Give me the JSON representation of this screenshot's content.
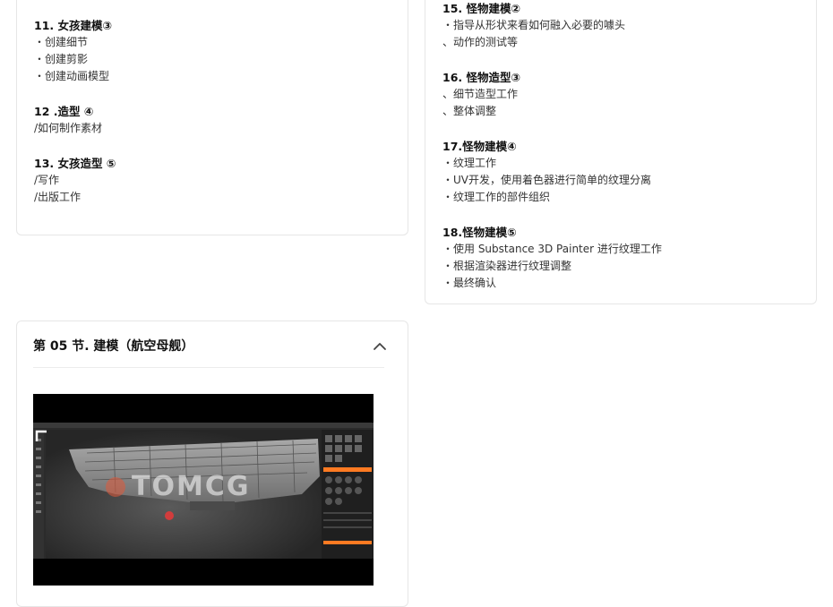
{
  "left_lessons": [
    {
      "title": "11. 女孩建模③",
      "lines": [
        "・创建细节",
        "・创建剪影",
        "・创建动画模型"
      ]
    },
    {
      "title": "12 .造型 ④",
      "lines": [
        "/如何制作素材"
      ]
    },
    {
      "title": "13. 女孩造型 ⑤",
      "lines": [
        "/写作",
        "/出版工作"
      ]
    }
  ],
  "right_lessons": [
    {
      "title": "15. 怪物建模②",
      "lines": [
        "・指导从形状来看如何融入必要的噱头",
        "、动作的测试等"
      ]
    },
    {
      "title": "16. 怪物造型③",
      "lines": [
        "、细节造型工作",
        "、整体调整"
      ]
    },
    {
      "title": "17.怪物建模④",
      "lines": [
        "・纹理工作",
        "・UV开发，使用着色器进行简单的纹理分离",
        "・纹理工作的部件组织"
      ]
    },
    {
      "title": "18.怪物建模⑤",
      "lines": [
        "・使用 Substance 3D Painter 进行纹理工作",
        "・根据渲染器进行纹理调整",
        "・最终确认"
      ]
    }
  ],
  "section": {
    "title": "第 05 节. 建模（航空母舰）",
    "watermark": "TOMCG"
  },
  "colors": {
    "accent": "#ff7a22",
    "border": "#e6e6e6"
  }
}
